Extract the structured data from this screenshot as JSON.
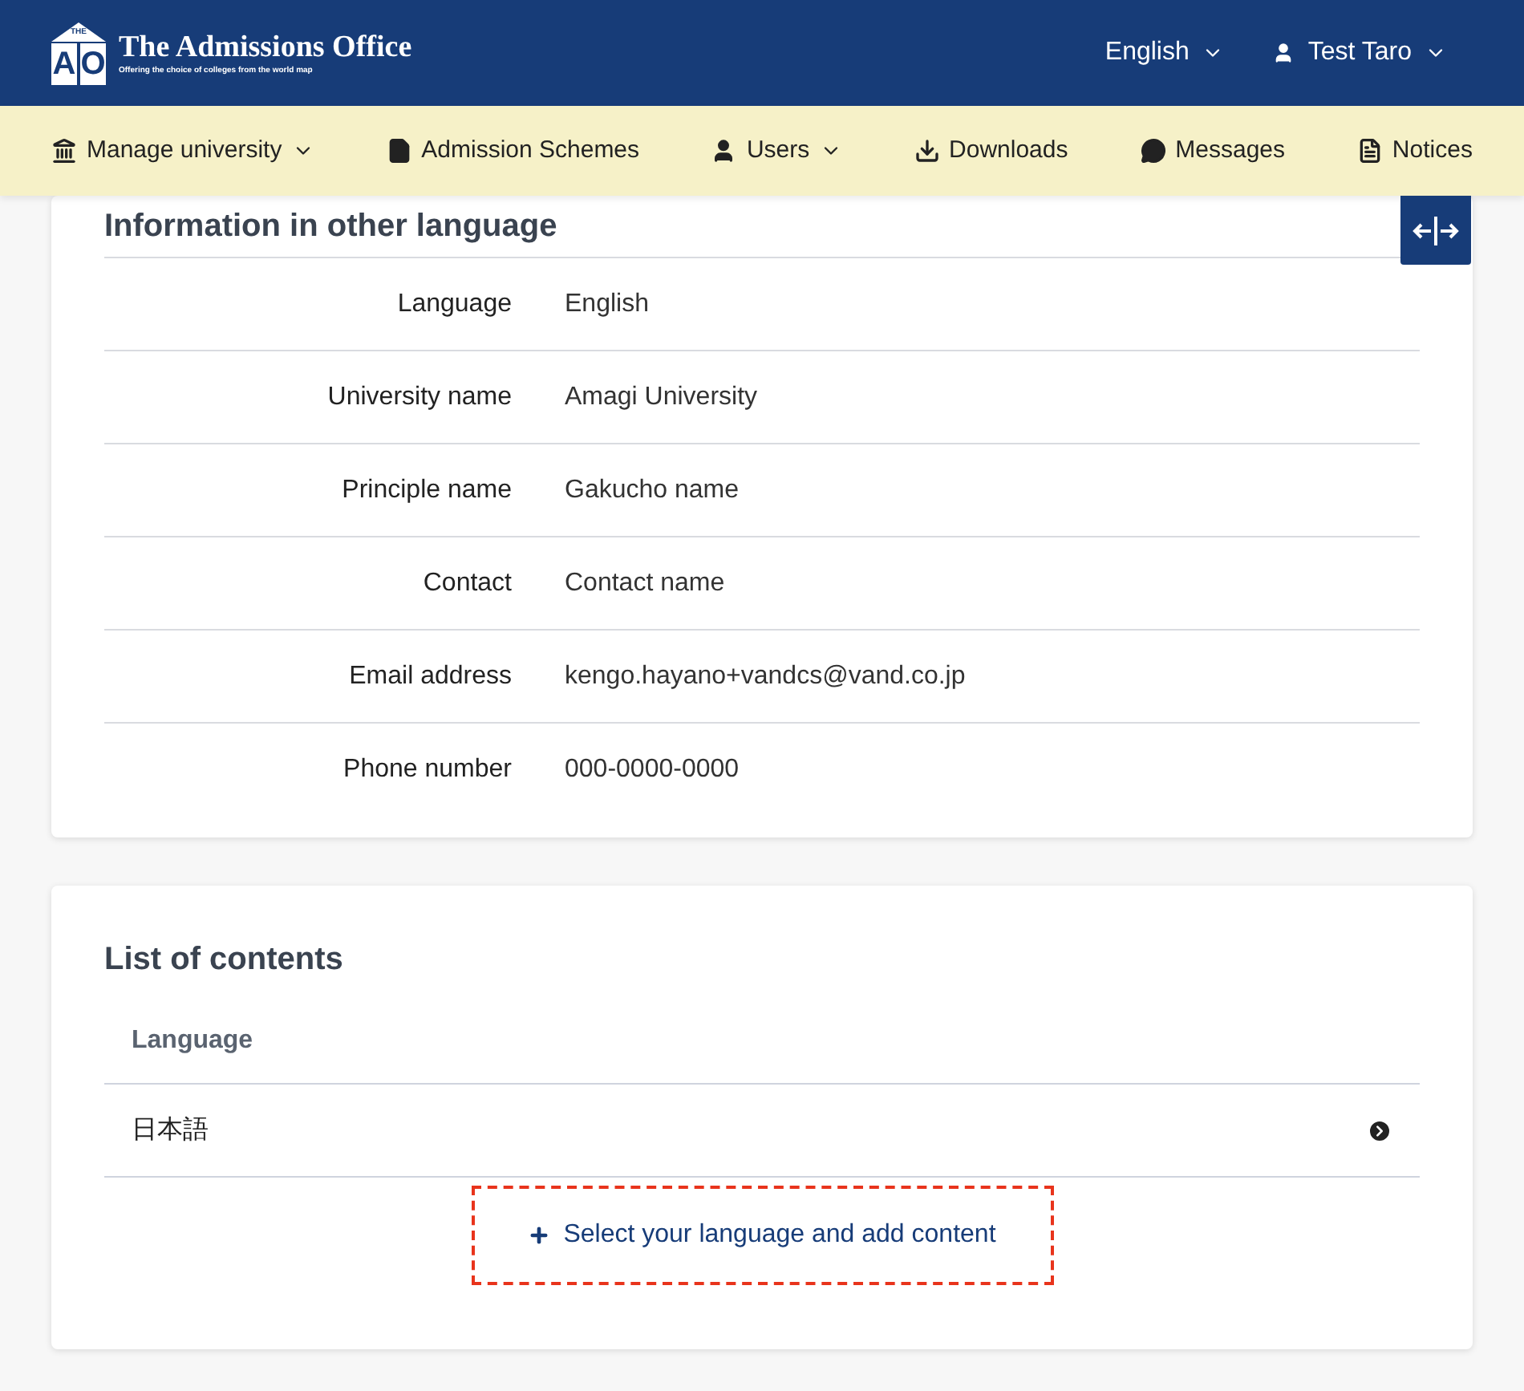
{
  "header": {
    "logo": {
      "roof_text": "THE",
      "letters": [
        "A",
        "O"
      ],
      "title": "The Admissions Office",
      "tagline": "Offering the choice of colleges from the world map"
    },
    "language": "English",
    "user": "Test Taro"
  },
  "nav": [
    {
      "label": "Manage university",
      "dropdown": true
    },
    {
      "label": "Admission Schemes",
      "dropdown": false
    },
    {
      "label": "Users",
      "dropdown": true
    },
    {
      "label": "Downloads",
      "dropdown": false
    },
    {
      "label": "Messages",
      "dropdown": false
    },
    {
      "label": "Notices",
      "dropdown": false
    }
  ],
  "info_card": {
    "title": "Information in other language",
    "rows": [
      {
        "label": "Language",
        "value": "English"
      },
      {
        "label": "University name",
        "value": "Amagi University"
      },
      {
        "label": "Principle name",
        "value": "Gakucho name"
      },
      {
        "label": "Contact",
        "value": "Contact name"
      },
      {
        "label": "Email address",
        "value": "kengo.hayano+vandcs@vand.co.jp"
      },
      {
        "label": "Phone number",
        "value": "000-0000-0000"
      }
    ]
  },
  "contents_card": {
    "title": "List of contents",
    "table": {
      "columns": [
        "Language"
      ],
      "rows": [
        {
          "cells": [
            "日本語"
          ]
        }
      ]
    },
    "add_button": "Select your language and add content"
  }
}
